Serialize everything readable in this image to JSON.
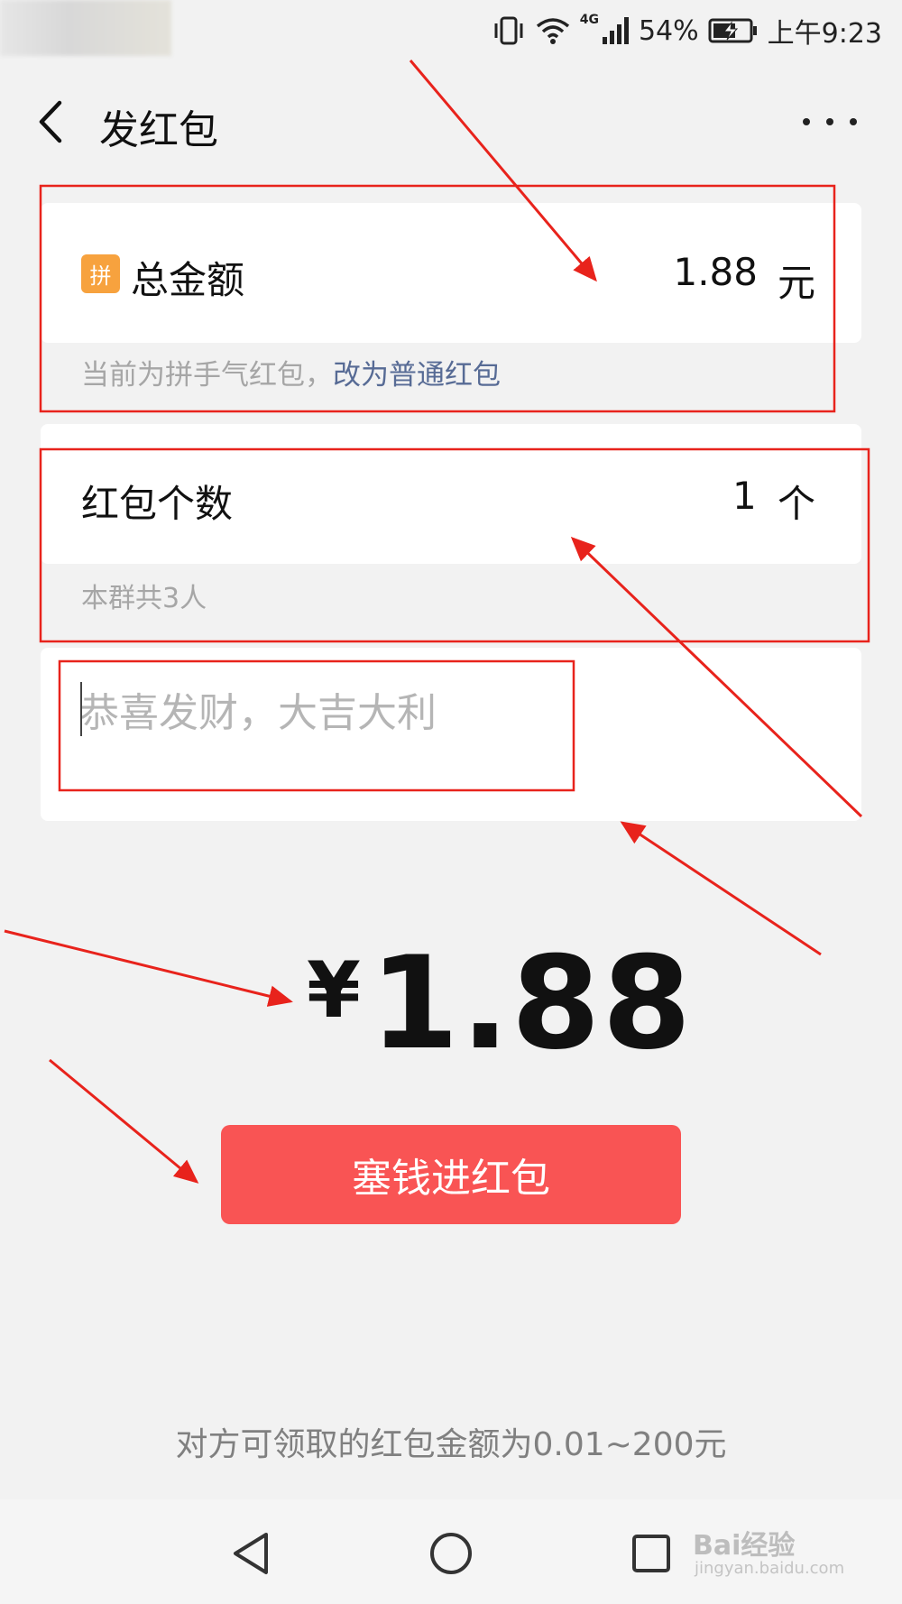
{
  "status_bar": {
    "battery": "54%",
    "time": "上午9:23",
    "network": "4G"
  },
  "header": {
    "title": "发红包"
  },
  "amount_card": {
    "badge": "拼",
    "label": "总金额",
    "value": "1.88",
    "unit": "元"
  },
  "hint": {
    "text": "当前为拼手气红包，",
    "link": "改为普通红包"
  },
  "count_card": {
    "label": "红包个数",
    "value": "1",
    "unit": "个"
  },
  "group_hint": "本群共3人",
  "message": {
    "placeholder": "恭喜发财，大吉大利"
  },
  "total": {
    "currency": "¥",
    "amount": "1.88"
  },
  "submit_label": "塞钱进红包",
  "footer_note": "对方可领取的红包金额为0.01~200元",
  "watermark": {
    "brand": "Bai经验",
    "url": "jingyan.baidu.com"
  },
  "colors": {
    "accent_red": "#f95454",
    "badge_orange": "#f7a23e",
    "link_blue": "#576b95",
    "annotation_red": "#e8231c"
  }
}
